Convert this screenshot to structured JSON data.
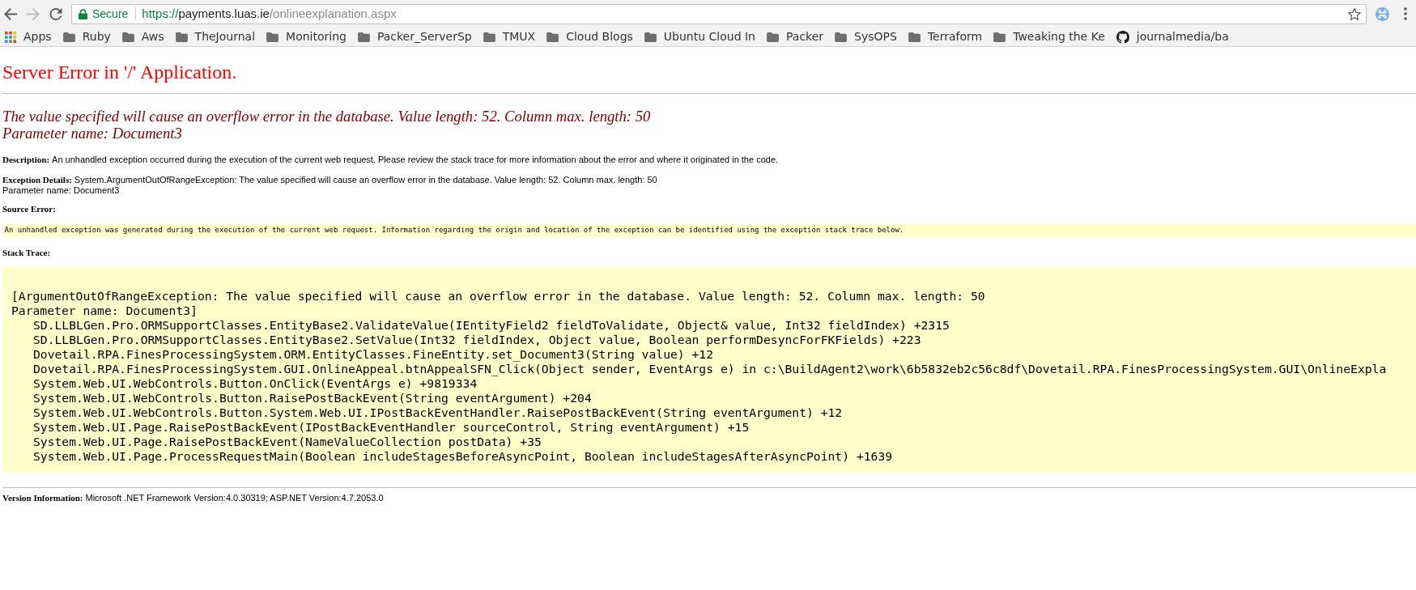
{
  "browser": {
    "nav_buttons": [
      {
        "kind": "back",
        "disabled": false
      },
      {
        "kind": "forward",
        "disabled": true
      },
      {
        "kind": "reload",
        "disabled": false
      }
    ],
    "address_bar": {
      "security_label": "Secure",
      "url_scheme": "https://",
      "url_host": "payments.luas.ie",
      "url_path": "/onlineexplanation.aspx"
    },
    "bookmarks": [
      {
        "kind": "apps",
        "label": "Apps"
      },
      {
        "kind": "folder",
        "label": "Ruby"
      },
      {
        "kind": "folder",
        "label": "Aws"
      },
      {
        "kind": "folder",
        "label": "TheJournal"
      },
      {
        "kind": "folder",
        "label": "Monitoring"
      },
      {
        "kind": "folder",
        "label": "Packer_ServerSp"
      },
      {
        "kind": "folder",
        "label": "TMUX"
      },
      {
        "kind": "folder",
        "label": "Cloud Blogs"
      },
      {
        "kind": "folder",
        "label": "Ubuntu Cloud In"
      },
      {
        "kind": "folder",
        "label": "Packer"
      },
      {
        "kind": "folder",
        "label": "SysOPS"
      },
      {
        "kind": "folder",
        "label": "Terraform"
      },
      {
        "kind": "folder",
        "label": "Tweaking the Ke"
      },
      {
        "kind": "link",
        "label": "journalmedia/ba"
      }
    ]
  },
  "page": {
    "title": "Server Error in '/' Application.",
    "error_message_lines": [
      "The value specified will cause an overflow error in the database. Value length: 52. Column max. length: 50",
      "Parameter name: Document3"
    ],
    "description": {
      "label": "Description:",
      "text": "An unhandled exception occurred during the execution of the current web request. Please review the stack trace for more information about the error and where it originated in the code."
    },
    "exception_details": {
      "label": "Exception Details:",
      "lines": [
        "System.ArgumentOutOfRangeException: The value specified will cause an overflow error in the database. Value length: 52. Column max. length: 50",
        "Parameter name: Document3"
      ]
    },
    "source_error": {
      "label": "Source Error:",
      "text": "An unhandled exception was generated during the execution of the current web request. Information regarding the origin and location of the exception can be identified using the exception stack trace below."
    },
    "stack_trace": {
      "label": "Stack Trace:",
      "message_lines": [
        "[ArgumentOutOfRangeException: The value specified will cause an overflow error in the database. Value length: 52. Column max. length: 50",
        "Parameter name: Document3]"
      ],
      "frames": [
        "SD.LLBLGen.Pro.ORMSupportClasses.EntityBase2.ValidateValue(IEntityField2 fieldToValidate, Object& value, Int32 fieldIndex) +2315",
        "SD.LLBLGen.Pro.ORMSupportClasses.EntityBase2.SetValue(Int32 fieldIndex, Object value, Boolean performDesyncForFKFields) +223",
        "Dovetail.RPA.FinesProcessingSystem.ORM.EntityClasses.FineEntity.set_Document3(String value) +12",
        "Dovetail.RPA.FinesProcessingSystem.GUI.OnlineAppeal.btnAppealSFN_Click(Object sender, EventArgs e) in c:\\BuildAgent2\\work\\6b5832eb2c56c8df\\Dovetail.RPA.FinesProcessingSystem.GUI\\OnlineExpla",
        "System.Web.UI.WebControls.Button.OnClick(EventArgs e) +9819334",
        "System.Web.UI.WebControls.Button.RaisePostBackEvent(String eventArgument) +204",
        "System.Web.UI.WebControls.Button.System.Web.UI.IPostBackEventHandler.RaisePostBackEvent(String eventArgument) +12",
        "System.Web.UI.Page.RaisePostBackEvent(IPostBackEventHandler sourceControl, String eventArgument) +15",
        "System.Web.UI.Page.RaisePostBackEvent(NameValueCollection postData) +35",
        "System.Web.UI.Page.ProcessRequestMain(Boolean includeStagesBeforeAsyncPoint, Boolean includeStagesAfterAsyncPoint) +1639"
      ]
    },
    "version_information": {
      "label": "Version Information:",
      "text": "Microsoft .NET Framework Version:4.0.30319; ASP.NET Version:4.7.2053.0"
    }
  }
}
